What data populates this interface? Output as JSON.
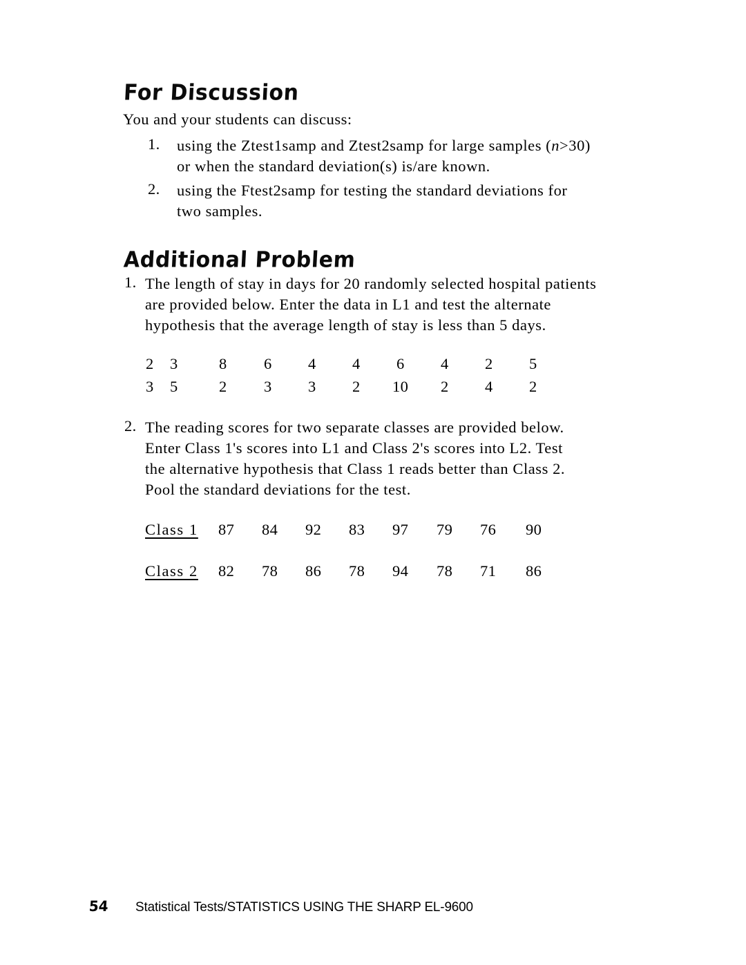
{
  "page": {
    "background_color": "#ffffff",
    "text_color": "#000000"
  },
  "section_discussion": {
    "heading": "For Discussion",
    "lead_in": "You and your students can discuss:",
    "items": [
      {
        "marker": "1.",
        "line1_a": "using the Ztest1samp and Ztest2samp for large samples (",
        "line1_italic": "n",
        "line1_b": ">30)",
        "line2": "or when the standard deviation(s) is/are known."
      },
      {
        "marker": "2.",
        "line1": "using the Ftest2samp for testing the standard deviations for",
        "line2": "two samples."
      }
    ]
  },
  "section_additional": {
    "heading": "Additional Problem",
    "problem1": {
      "marker": "1.",
      "line1": "The length of stay in days for 20 randomly selected hospital patients",
      "line2": "are provided below.  Enter the data in L1 and test the alternate",
      "line3": "hypothesis that the average length of stay is less than 5 days."
    },
    "stay_data": {
      "row1": [
        "2",
        "3",
        "8",
        "6",
        "4",
        "4",
        "6",
        "4",
        "2",
        "5"
      ],
      "row2": [
        "3",
        "5",
        "2",
        "3",
        "3",
        "2",
        "10",
        "2",
        "4",
        "2"
      ]
    },
    "problem2": {
      "marker": "2.",
      "line1": "The reading scores for two separate classes are provided below.",
      "line2": "Enter Class 1's scores into L1 and Class 2's scores into L2.  Test",
      "line3": "the alternative hypothesis that Class 1 reads better than Class 2.",
      "line4": "Pool the standard deviations for the test."
    },
    "reading_scores": {
      "class1_label": "Class 1",
      "class1_values": [
        "87",
        "84",
        "92",
        "83",
        "97",
        "79",
        "76",
        "90"
      ],
      "class2_label": "Class 2",
      "class2_values": [
        "82",
        "78",
        "86",
        "78",
        "94",
        "78",
        "71",
        "86"
      ]
    }
  },
  "footer": {
    "page_number": "54",
    "running_title": "Statistical Tests/STATISTICS USING THE SHARP EL-9600"
  }
}
